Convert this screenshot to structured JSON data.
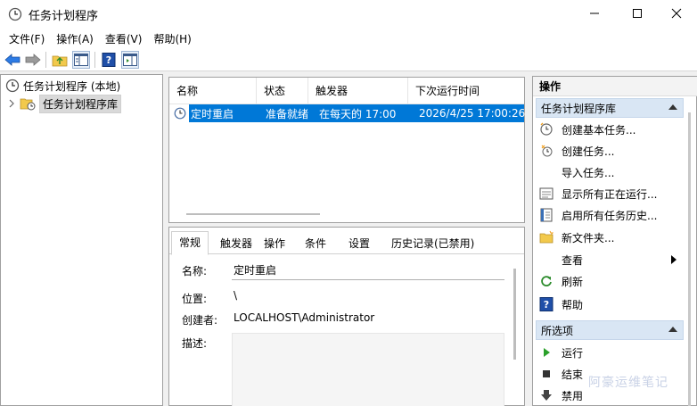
{
  "window": {
    "title": "任务计划程序",
    "controls": [
      "minimize",
      "maximize",
      "close"
    ]
  },
  "menu": {
    "items": [
      "文件(F)",
      "操作(A)",
      "查看(V)",
      "帮助(H)"
    ]
  },
  "toolbar": {
    "icons": [
      "back-icon",
      "forward-icon",
      "folder-up-icon",
      "show-hide-console-tree-icon",
      "help-icon",
      "show-hide-action-pane-icon"
    ]
  },
  "tree": {
    "root": "任务计划程序 (本地)",
    "child": "任务计划程序库"
  },
  "task_list": {
    "columns": [
      "名称",
      "状态",
      "触发器",
      "下次运行时间"
    ],
    "rows": [
      {
        "name": "定时重启",
        "status": "准备就绪",
        "trigger": "在每天的 17:00",
        "next_run": "2026/4/25 17:00:26"
      }
    ]
  },
  "details": {
    "tabs": [
      "常规",
      "触发器",
      "操作",
      "条件",
      "设置",
      "历史记录(已禁用)"
    ],
    "active_tab": "常规",
    "fields": {
      "name_label": "名称:",
      "name_value": "定时重启",
      "location_label": "位置:",
      "location_value": "\\",
      "author_label": "创建者:",
      "author_value": "LOCALHOST\\Administrator",
      "description_label": "描述:"
    }
  },
  "actions": {
    "title": "操作",
    "section1": {
      "title": "任务计划程序库",
      "items": [
        {
          "label": "创建基本任务...",
          "icon": "create-basic-task-icon"
        },
        {
          "label": "创建任务...",
          "icon": "create-task-icon"
        },
        {
          "label": "导入任务...",
          "icon": ""
        },
        {
          "label": "显示所有正在运行...",
          "icon": "running-tasks-icon"
        },
        {
          "label": "启用所有任务历史...",
          "icon": "task-history-icon"
        },
        {
          "label": "新文件夹...",
          "icon": "new-folder-icon"
        },
        {
          "label": "查看",
          "icon": ""
        },
        {
          "label": "刷新",
          "icon": "refresh-icon"
        },
        {
          "label": "帮助",
          "icon": "help-icon"
        }
      ]
    },
    "section2": {
      "title": "所选项",
      "items": [
        {
          "label": "运行",
          "icon": "run-icon"
        },
        {
          "label": "结束",
          "icon": "stop-icon"
        },
        {
          "label": "禁用",
          "icon": "disable-icon"
        }
      ]
    }
  },
  "watermark": "阿豪运维笔记",
  "colors": {
    "selection": "#0078d7",
    "section_header": "#d9e6f4"
  }
}
